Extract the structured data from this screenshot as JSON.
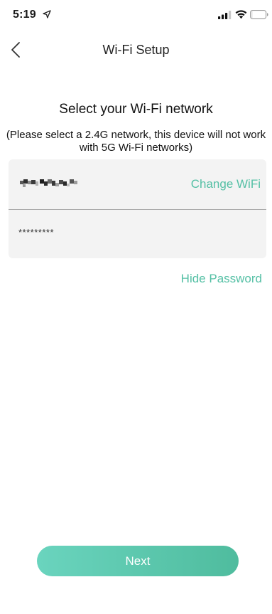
{
  "status_bar": {
    "time": "5:19"
  },
  "nav": {
    "title": "Wi-Fi Setup"
  },
  "heading": "Select your Wi-Fi network",
  "note": "(Please select a 2.4G network, this device will not work with 5G Wi-Fi networks)",
  "network": {
    "change_label": "Change WiFi",
    "password_value": "*********"
  },
  "hide_password_label": "Hide Password",
  "next_label": "Next",
  "colors": {
    "accent": "#55c0a5",
    "button_start": "#6ad4be",
    "button_end": "#4fbc9e",
    "card_bg": "#f3f3f3"
  },
  "icons": {
    "location": "location-arrow-icon",
    "signal": "cellular-signal-icon",
    "wifi": "wifi-icon",
    "battery": "battery-icon",
    "back": "chevron-left-icon"
  }
}
